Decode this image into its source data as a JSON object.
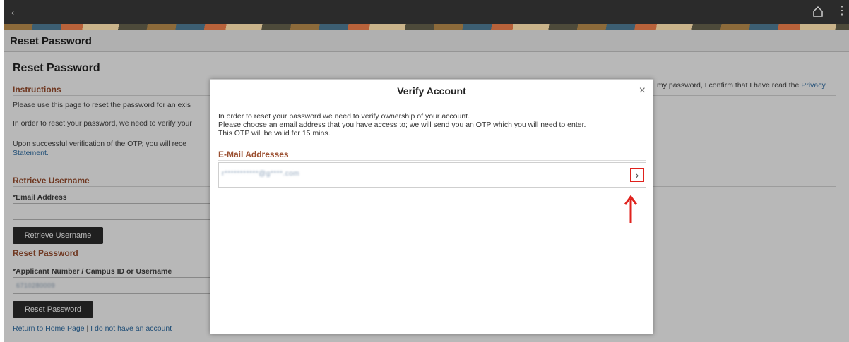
{
  "browser": {
    "back_icon": "back-arrow-icon",
    "home_icon": "home-icon",
    "menu_icon": "kebab-menu-icon"
  },
  "header": {
    "title": "Reset Password"
  },
  "page": {
    "heading": "Reset Password",
    "instructions_title": "Instructions",
    "instructions_p1": "Please use this page to reset the password for an exis",
    "instructions_p2": "In order to reset your password, we need to verify your",
    "instructions_p3_a": "Upon successful verification of the OTP, you will rece",
    "instructions_p3_b": "Statement.",
    "instructions_right": "my password, I confirm that I have read the",
    "privacy_link": "Privacy",
    "retrieve_title": "Retrieve Username",
    "email_label": "*Email Address",
    "retrieve_button": "Retrieve Username",
    "reset_title": "Reset Password",
    "applicant_label": "*Applicant Number / Campus ID or Username",
    "applicant_value": "6710280009",
    "reset_button": "Reset Password",
    "link_home": "Return to Home Page",
    "link_sep": "|",
    "link_no_account": "I do not have an account"
  },
  "modal": {
    "title": "Verify Account",
    "close": "×",
    "line1": "In order to reset your password we need to verify ownership of your account.",
    "line2": "Please choose an email address that you have access to; we will send you an OTP which you will need to enter.",
    "line3": "This OTP will be valid for 15 mins.",
    "email_section": "E-Mail Addresses",
    "email_value": "r***********@g****.com",
    "chevron": "›"
  },
  "colors": {
    "accent": "#9b4f30",
    "link": "#2f6ea6",
    "highlight": "#e0221d"
  }
}
